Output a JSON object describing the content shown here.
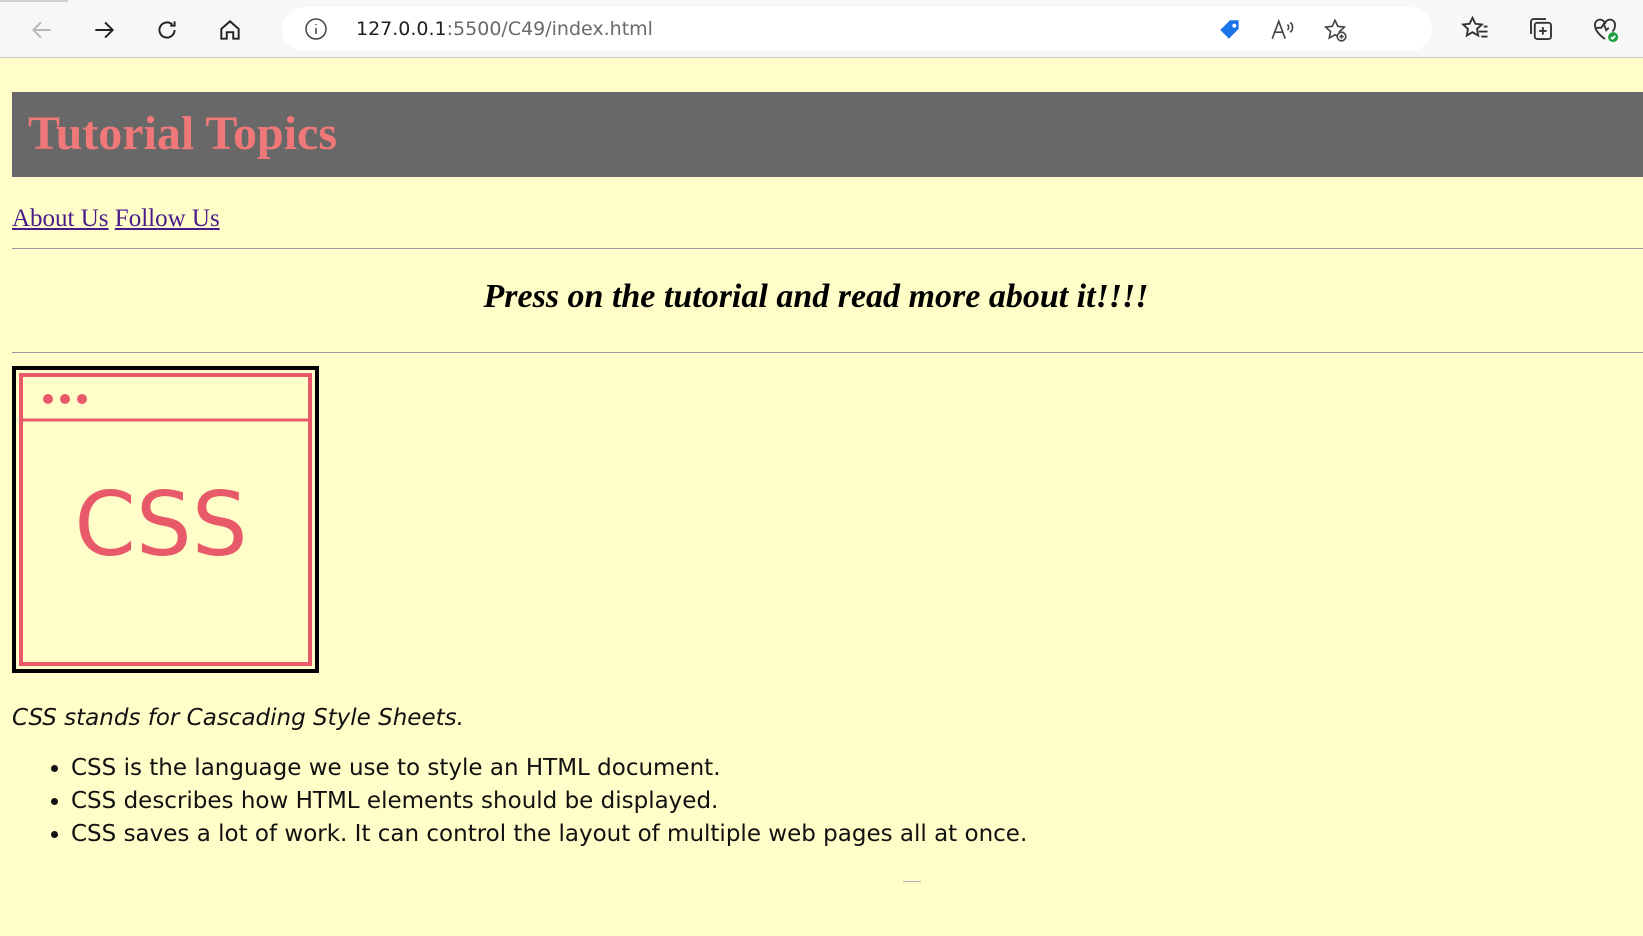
{
  "browser": {
    "url_host": "127.0.0.1",
    "url_rest": ":5500/C49/index.html"
  },
  "page": {
    "title": "Tutorial Topics",
    "nav": [
      {
        "label": "About Us"
      },
      {
        "label": "Follow Us"
      }
    ],
    "tagline": "Press on the tutorial and read more about it!!!!",
    "image_label": "CSS",
    "description": "CSS stands for Cascading Style Sheets.",
    "points": [
      "CSS is the language we use to style an HTML document.",
      "CSS describes how HTML elements should be displayed.",
      "CSS saves a lot of work. It can control the layout of multiple web pages all at once."
    ]
  },
  "colors": {
    "background": "#fffdc8",
    "header_bg": "#686868",
    "title_color": "#f07878",
    "link_color": "#4a1a8a",
    "css_accent": "#e85a6a"
  },
  "icons": [
    "back-icon",
    "forward-icon",
    "refresh-icon",
    "home-icon",
    "info-icon",
    "shopping-tag-icon",
    "read-aloud-icon",
    "add-favorite-icon",
    "favorites-icon",
    "collections-icon",
    "browser-essentials-icon"
  ]
}
